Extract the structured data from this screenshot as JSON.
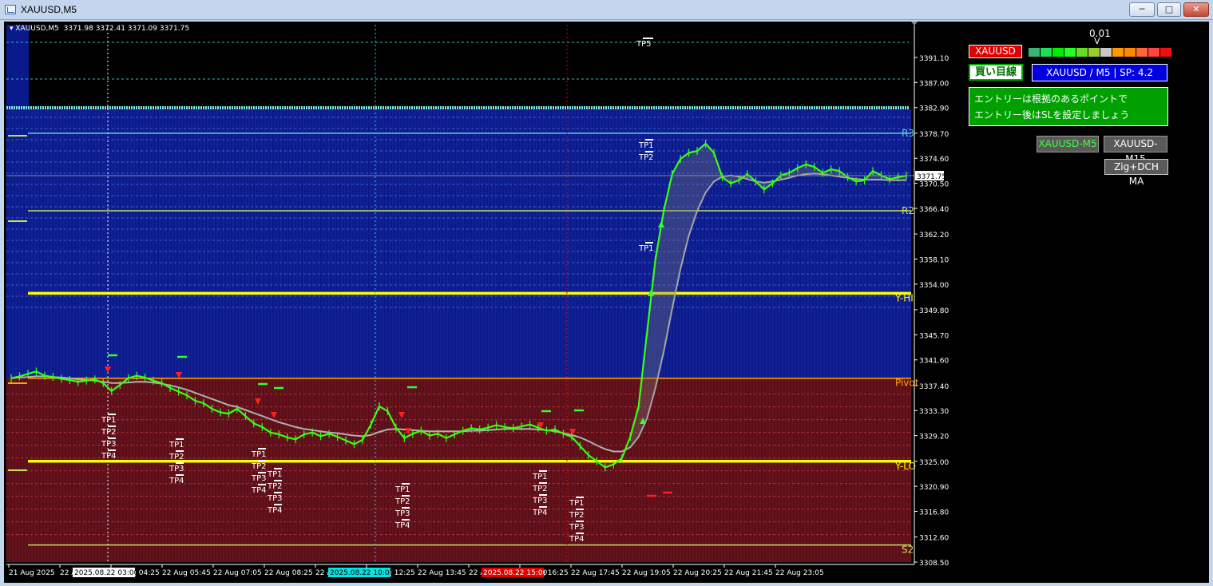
{
  "window": {
    "title": "XAUUSD,M5",
    "buttons": {
      "minimize": "─",
      "restore": "□",
      "close": "✕"
    }
  },
  "chart_header": {
    "symbol": "XAUUSD,M5",
    "ohlc": "3371.98 3372.41 3371.09 3371.75"
  },
  "panels": {
    "symbol_label": "XAUUSD",
    "buy_label": "買い目線",
    "spread_label": "XAUUSD / M5  |  SP: 4.2",
    "message_line1": "エントリーは根拠のあるポイントで",
    "message_line2": "エントリー後はSLを設定しましょう",
    "tf_button_1": "XAUUSD-M5",
    "tf_button_2": "XAUUSD-M15",
    "indicator_button": "Zig+DCH MA",
    "strength_value": "0.01",
    "strength_marker": "V",
    "strength_colors": [
      "#3cb371",
      "#22dd55",
      "#00ee00",
      "#22ff22",
      "#66dd22",
      "#99cc33",
      "#c8c8c8",
      "#ff9900",
      "#ff8800",
      "#ff6633",
      "#ff4444",
      "#ee1111"
    ]
  },
  "colors": {
    "bull_zone": "#0a1a8c",
    "bear_zone": "#5a0f18",
    "candle": "#39ff14",
    "ma": "#b0b0b0",
    "pivot": "#ffa500",
    "level": "#ffff00",
    "grid_text": "#ffffff"
  },
  "chart_data": {
    "type": "line",
    "price_axis": {
      "ticks": [
        "3391.10",
        "3387.00",
        "3382.90",
        "3378.70",
        "3374.60",
        "3370.50",
        "3366.40",
        "3362.20",
        "3358.10",
        "3354.00",
        "3349.80",
        "3345.70",
        "3341.60",
        "3337.40",
        "3333.30",
        "3329.20",
        "3325.00",
        "3320.90",
        "3316.80",
        "3312.60",
        "3308.50"
      ],
      "min": 3308.5,
      "max": 3391.1,
      "current_label": "3371.75",
      "current": 3371.75
    },
    "time_axis": {
      "ticks": [
        "21 Aug 2025",
        "22 Aug 03:05",
        "22 Aug 04:25",
        "22 Aug 05:45",
        "22 Aug 07:05",
        "22 Aug 08:25",
        "22 Aug 11:05",
        "22 Aug 12:25",
        "22 Aug 13:45",
        "22 Aug 15:05",
        "22 Aug 16:25",
        "22 Aug 17:45",
        "22 Aug 19:05",
        "22 Aug 20:25",
        "22 Aug 21:45",
        "22 Aug 23:05"
      ],
      "markers": [
        {
          "label": "2025.08.22 03:00",
          "color": "#ffffff",
          "text_color": "#000000",
          "index": 1
        },
        {
          "label": "2025.08.22 10:00",
          "color": "#00e5e5",
          "text_color": "#000000",
          "index": 6
        },
        {
          "label": "2025.08.22 15:00",
          "color": "#e00000",
          "text_color": "#ffffff",
          "index": 9
        }
      ]
    },
    "levels": [
      {
        "name": "R3",
        "value": 3378.7,
        "color": "#5fd0e0"
      },
      {
        "name": "R2",
        "value": 3366.0,
        "color": "#c8e05a"
      },
      {
        "name": "Y-HI",
        "value": 3352.5,
        "color": "#ffff00"
      },
      {
        "name": "Pivot",
        "value": 3338.6,
        "color": "#ffa500"
      },
      {
        "name": "Y-LO",
        "value": 3325.0,
        "color": "#ffff00"
      },
      {
        "name": "S2",
        "value": 3311.3,
        "color": "#c8e05a"
      }
    ],
    "price_series": [
      3338.6,
      3338.9,
      3339.3,
      3339.7,
      3339.0,
      3338.8,
      3338.5,
      3338.3,
      3338.0,
      3338.2,
      3338.4,
      3337.8,
      3336.5,
      3337.5,
      3338.6,
      3339.0,
      3338.7,
      3338.2,
      3337.8,
      3337.0,
      3336.4,
      3335.8,
      3334.9,
      3334.5,
      3333.6,
      3333.0,
      3332.8,
      3333.6,
      3332.4,
      3331.2,
      3330.6,
      3329.7,
      3329.4,
      3328.9,
      3328.6,
      3329.4,
      3329.7,
      3329.1,
      3329.5,
      3329.0,
      3328.4,
      3327.8,
      3328.5,
      3331.0,
      3334.0,
      3333.2,
      3330.5,
      3328.8,
      3329.5,
      3330.0,
      3329.2,
      3329.5,
      3328.8,
      3329.4,
      3330.0,
      3330.4,
      3330.2,
      3330.5,
      3330.9,
      3330.6,
      3330.4,
      3330.7,
      3331.0,
      3330.5,
      3330.0,
      3330.2,
      3329.5,
      3329.0,
      3327.5,
      3326.0,
      3325.0,
      3324.0,
      3324.5,
      3325.5,
      3329.0,
      3334.0,
      3346.0,
      3358.0,
      3366.0,
      3372.0,
      3374.5,
      3375.5,
      3375.8,
      3377.0,
      3375.5,
      3371.5,
      3370.5,
      3371.0,
      3372.0,
      3370.8,
      3369.5,
      3370.5,
      3371.8,
      3372.2,
      3373.0,
      3373.6,
      3373.2,
      3372.2,
      3372.8,
      3372.5,
      3371.5,
      3370.8,
      3371.0,
      3372.5,
      3371.8,
      3371.2,
      3371.5,
      3371.75
    ],
    "ma_series": [
      3338.6,
      3338.7,
      3338.8,
      3338.9,
      3338.9,
      3338.8,
      3338.7,
      3338.6,
      3338.4,
      3338.3,
      3338.2,
      3338.0,
      3337.8,
      3337.8,
      3337.9,
      3338.0,
      3338.0,
      3337.9,
      3337.7,
      3337.4,
      3337.1,
      3336.7,
      3336.2,
      3335.7,
      3335.2,
      3334.7,
      3334.2,
      3333.9,
      3333.4,
      3332.9,
      3332.4,
      3331.9,
      3331.4,
      3331.0,
      3330.6,
      3330.3,
      3330.1,
      3329.9,
      3329.7,
      3329.6,
      3329.4,
      3329.2,
      3329.1,
      3329.3,
      3329.8,
      3330.2,
      3330.3,
      3330.2,
      3330.1,
      3330.0,
      3329.9,
      3329.9,
      3329.9,
      3329.9,
      3329.9,
      3330.0,
      3330.0,
      3330.1,
      3330.2,
      3330.3,
      3330.3,
      3330.3,
      3330.3,
      3330.2,
      3330.1,
      3329.9,
      3329.6,
      3329.3,
      3328.9,
      3328.3,
      3327.6,
      3327.0,
      3326.6,
      3326.6,
      3327.3,
      3329.0,
      3332.0,
      3337.0,
      3343.0,
      3350.0,
      3356.5,
      3362.0,
      3366.0,
      3369.0,
      3370.8,
      3371.6,
      3371.8,
      3371.6,
      3371.2,
      3370.8,
      3370.6,
      3370.8,
      3371.1,
      3371.4,
      3371.8,
      3372.0,
      3372.1,
      3372.0,
      3371.8,
      3371.6,
      3371.4,
      3371.2,
      3371.1,
      3371.1,
      3371.1,
      3371.0,
      3371.0,
      3371.0
    ],
    "tp_labels": [
      "TP1",
      "TP2",
      "TP3",
      "TP4",
      "TP5"
    ],
    "signals": {
      "buy": 5,
      "sell": 7
    }
  }
}
